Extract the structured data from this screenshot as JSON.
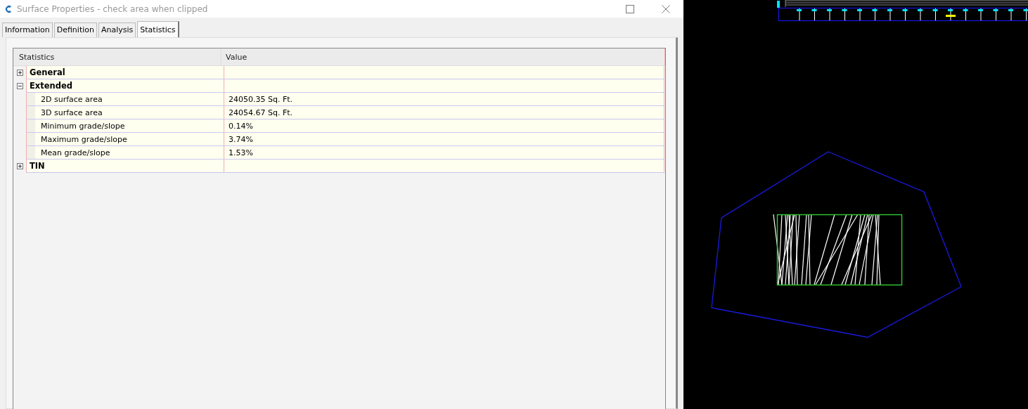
{
  "window": {
    "title": "Surface Properties - check area when clipped"
  },
  "tabs": [
    {
      "label": "Information",
      "selected": false
    },
    {
      "label": "Definition",
      "selected": false
    },
    {
      "label": "Analysis",
      "selected": false
    },
    {
      "label": "Statistics",
      "selected": true
    }
  ],
  "table": {
    "columns": [
      "Statistics",
      "Value"
    ],
    "groups": [
      {
        "label": "General",
        "expanded": false
      },
      {
        "label": "Extended",
        "expanded": true,
        "children": [
          {
            "label": "2D surface area",
            "value": "24050.35 Sq. Ft."
          },
          {
            "label": "3D surface area",
            "value": "24054.67 Sq. Ft."
          },
          {
            "label": "Minimum grade/slope",
            "value": "0.14%"
          },
          {
            "label": "Maximum grade/slope",
            "value": "3.74%"
          },
          {
            "label": "Mean grade/slope",
            "value": "1.53%"
          }
        ]
      },
      {
        "label": "TIN",
        "expanded": false
      }
    ]
  }
}
